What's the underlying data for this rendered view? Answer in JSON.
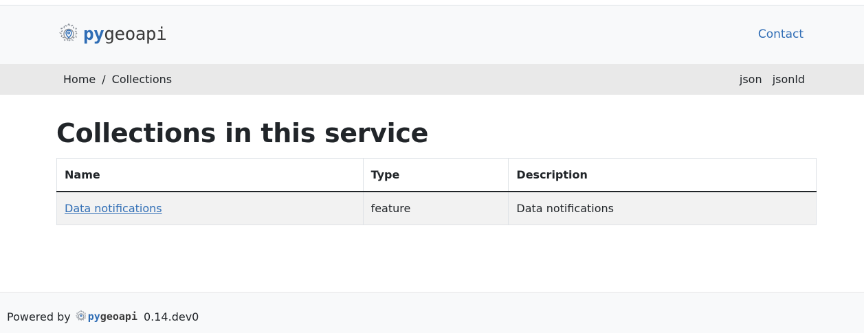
{
  "header": {
    "logo_py": "py",
    "logo_geoapi": "geoapi",
    "contact_label": "Contact"
  },
  "breadcrumb": {
    "home": "Home",
    "separator": "/",
    "current": "Collections"
  },
  "formats": {
    "json": "json",
    "jsonld": "jsonld"
  },
  "main": {
    "title": "Collections in this service",
    "table": {
      "headers": [
        "Name",
        "Type",
        "Description"
      ],
      "rows": [
        {
          "name": "Data notifications",
          "type": "feature",
          "description": "Data notifications"
        }
      ]
    }
  },
  "footer": {
    "powered_by": "Powered by",
    "logo_py": "py",
    "logo_geoapi": "geoapi",
    "version": "0.14.dev0"
  },
  "colors": {
    "link": "#2f6db5",
    "header_bg": "#f8f9fa",
    "breadcrumb_bg": "#e9e9e9",
    "row_bg": "#f2f2f2"
  },
  "icons": {
    "logo": "gear-globe-icon"
  }
}
